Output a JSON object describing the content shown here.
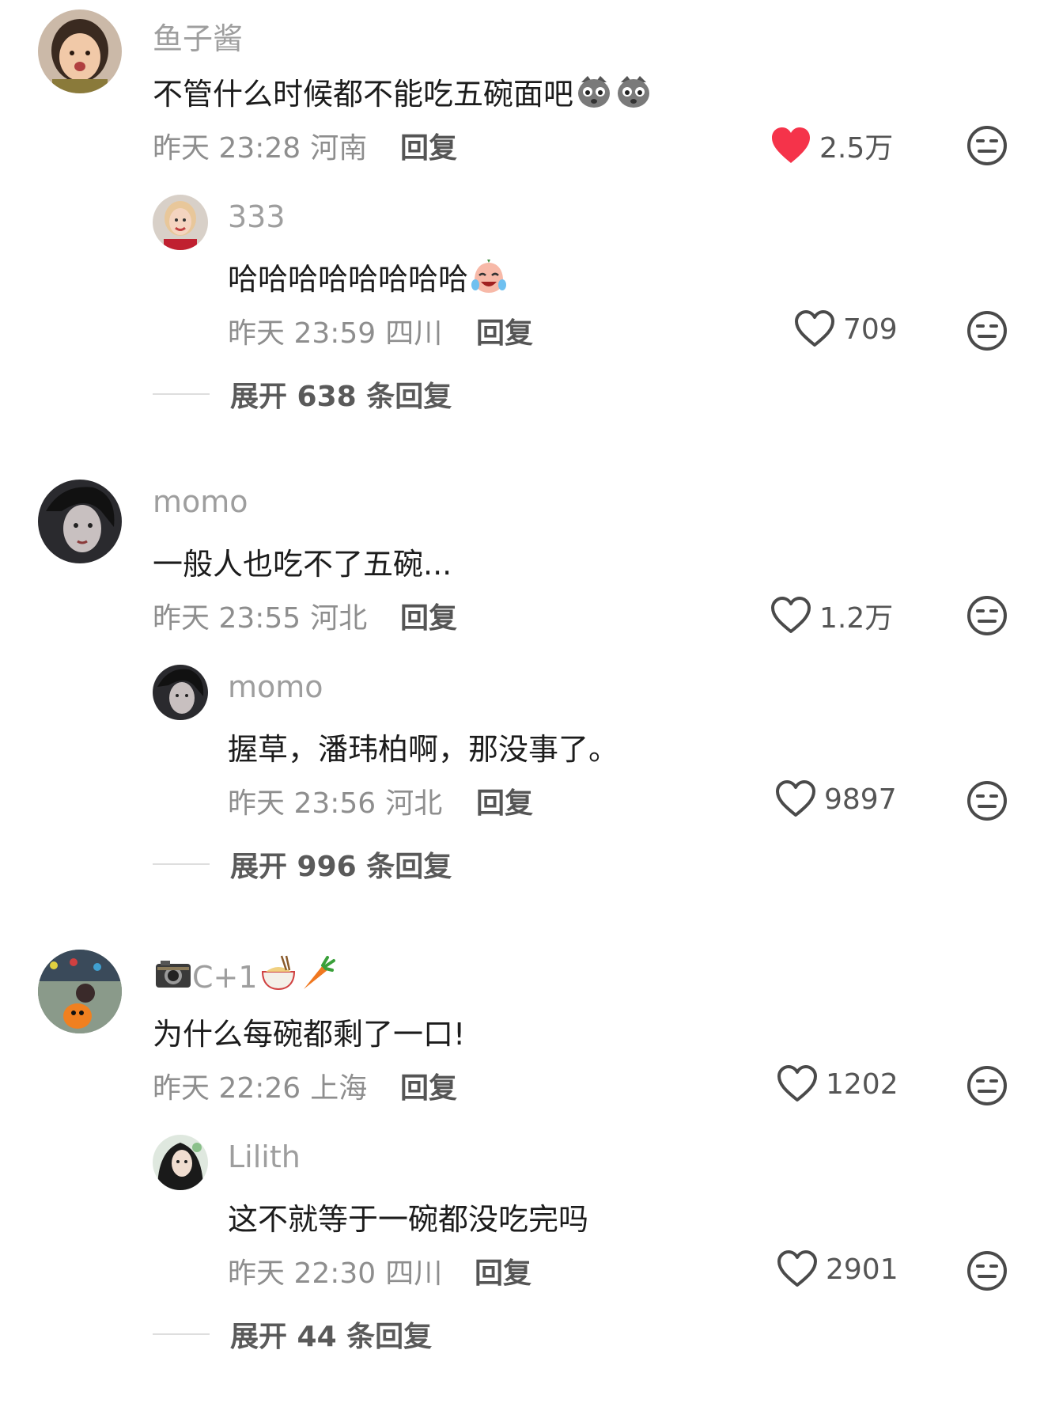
{
  "threads": [
    {
      "main": {
        "username": "鱼子酱",
        "text": "不管什么时候都不能吃五碗面吧",
        "emojis": [
          "puppy-face-emoji",
          "puppy-face-emoji"
        ],
        "date": "昨天 23:28",
        "location": "河南",
        "reply_label": "回复",
        "likes": "2.5万",
        "liked": true
      },
      "reply": {
        "username": "333",
        "text": "哈哈哈哈哈哈哈哈",
        "emojis": [
          "laughing-crying-emoji"
        ],
        "date": "昨天 23:59",
        "location": "四川",
        "reply_label": "回复",
        "likes": "709"
      },
      "expand": "展开 638 条回复"
    },
    {
      "main": {
        "username": "momo",
        "text": "一般人也吃不了五碗...",
        "date": "昨天 23:55",
        "location": "河北",
        "reply_label": "回复",
        "likes": "1.2万"
      },
      "reply": {
        "username": "momo",
        "text": "握草，潘玮柏啊，那没事了。",
        "date": "昨天 23:56",
        "location": "河北",
        "reply_label": "回复",
        "likes": "9897"
      },
      "expand": "展开 996 条回复"
    },
    {
      "main": {
        "username": "C+1",
        "username_prefix_icon": "camera-emoji",
        "username_suffix_icons": [
          "noodle-bowl-emoji",
          "carrot-emoji"
        ],
        "text": "为什么每碗都剩了一口!",
        "date": "昨天 22:26",
        "location": "上海",
        "reply_label": "回复",
        "likes": "1202"
      },
      "reply": {
        "username": "Lilith",
        "text": "这不就等于一碗都没吃完吗",
        "date": "昨天 22:30",
        "location": "四川",
        "reply_label": "回复",
        "likes": "2901"
      },
      "expand": "展开 44 条回复"
    }
  ],
  "colors": {
    "liked_heart": "#f5334a",
    "text_primary": "#1c1c1c",
    "text_secondary": "#8e8e8e",
    "icon_gray": "#4a4a4a"
  }
}
